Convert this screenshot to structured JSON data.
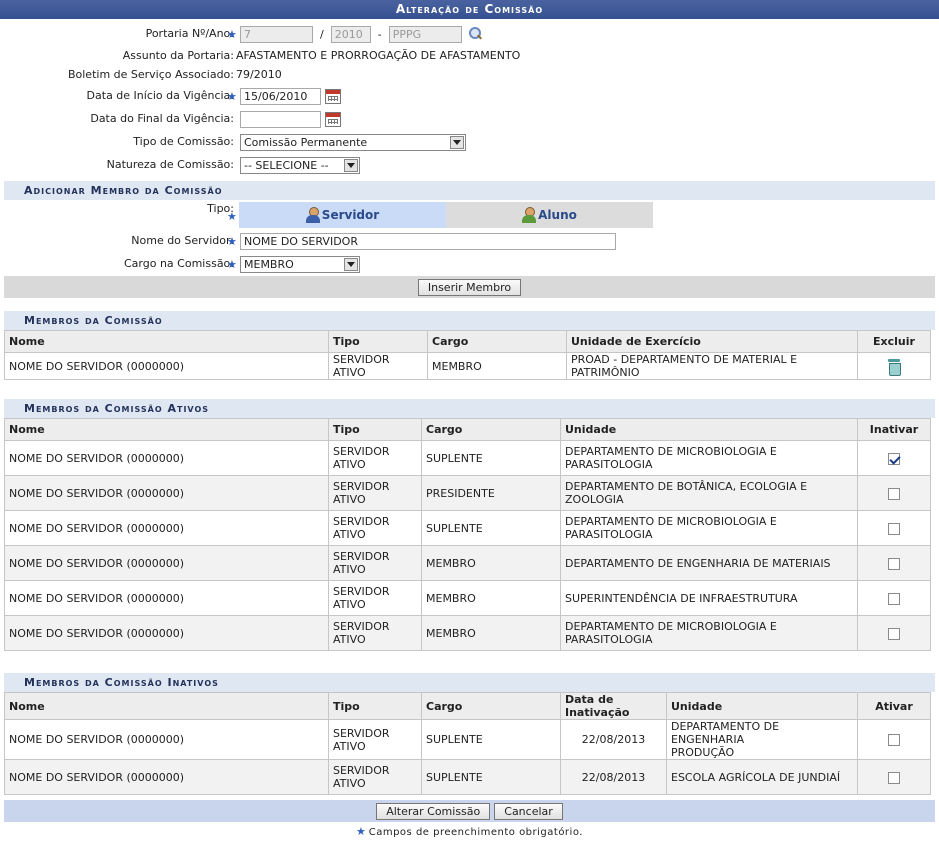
{
  "window": {
    "title": "Alteração de Comissão"
  },
  "form": {
    "portaria": {
      "label": "Portaria Nº/Ano:",
      "numero": "7",
      "sep1": "/",
      "ano": "2010",
      "sep2": "-",
      "sigla": "PPPG"
    },
    "assunto": {
      "label": "Assunto da Portaria:",
      "value": "AFASTAMENTO E PRORROGAÇÃO DE AFASTAMENTO"
    },
    "boletim": {
      "label": "Boletim de Serviço Associado:",
      "value": "79/2010"
    },
    "inicio": {
      "label": "Data de Início da Vigência:",
      "value": "15/06/2010"
    },
    "final": {
      "label": "Data do Final da Vigência:",
      "value": ""
    },
    "tipo": {
      "label": "Tipo de Comissão:",
      "value": "Comissão Permanente"
    },
    "natureza": {
      "label": "Natureza de Comissão:",
      "value": "-- SELECIONE --"
    }
  },
  "adicionar": {
    "title": "Adicionar Membro da Comissão",
    "tipo_label": "Tipo:",
    "tab_servidor": "Servidor",
    "tab_aluno": "Aluno",
    "nome_label": "Nome do Servidor:",
    "nome_value": "NOME DO SERVIDOR",
    "cargo_label": "Cargo na Comissão:",
    "cargo_value": "MEMBRO",
    "inserir_button": "Inserir Membro"
  },
  "membros": {
    "title": "Membros da Comissão",
    "headers": [
      "Nome",
      "Tipo",
      "Cargo",
      "Unidade de Exercício",
      "Excluir"
    ],
    "rows": [
      {
        "nome": "NOME DO SERVIDOR (0000000)",
        "tipo": "SERVIDOR ATIVO",
        "cargo": "MEMBRO",
        "unidade": "PROAD - DEPARTAMENTO DE MATERIAL E PATRIMÔNIO"
      }
    ]
  },
  "ativos": {
    "title": "Membros da Comissão Ativos",
    "headers": [
      "Nome",
      "Tipo",
      "Cargo",
      "Unidade",
      "Inativar"
    ],
    "rows": [
      {
        "nome": "NOME DO SERVIDOR (0000000)",
        "tipo1": "SERVIDOR",
        "tipo2": "ATIVO",
        "cargo": "SUPLENTE",
        "unidade": "DEPARTAMENTO DE MICROBIOLOGIA E PARASITOLOGIA",
        "checked": true
      },
      {
        "nome": "NOME DO SERVIDOR (0000000)",
        "tipo1": "SERVIDOR",
        "tipo2": "ATIVO",
        "cargo": "PRESIDENTE",
        "unidade": "DEPARTAMENTO DE BOTÂNICA, ECOLOGIA E ZOOLOGIA",
        "checked": false
      },
      {
        "nome": "NOME DO SERVIDOR (0000000)",
        "tipo1": "SERVIDOR",
        "tipo2": "ATIVO",
        "cargo": "SUPLENTE",
        "unidade": "DEPARTAMENTO DE MICROBIOLOGIA E PARASITOLOGIA",
        "checked": false
      },
      {
        "nome": "NOME DO SERVIDOR (0000000)",
        "tipo1": "SERVIDOR",
        "tipo2": "ATIVO",
        "cargo": "MEMBRO",
        "unidade": "DEPARTAMENTO DE ENGENHARIA DE MATERIAIS",
        "checked": false
      },
      {
        "nome": "NOME DO SERVIDOR (0000000)",
        "tipo1": "SERVIDOR",
        "tipo2": "ATIVO",
        "cargo": "MEMBRO",
        "unidade": "SUPERINTENDÊNCIA DE INFRAESTRUTURA",
        "checked": false
      },
      {
        "nome": "NOME DO SERVIDOR (0000000)",
        "tipo1": "SERVIDOR",
        "tipo2": "ATIVO",
        "cargo": "MEMBRO",
        "unidade": "DEPARTAMENTO DE MICROBIOLOGIA E PARASITOLOGIA",
        "checked": false
      }
    ]
  },
  "inativos": {
    "title": "Membros da Comissão Inativos",
    "headers": [
      "Nome",
      "Tipo",
      "Cargo",
      "Data de Inativação",
      "Unidade",
      "Ativar"
    ],
    "rows": [
      {
        "nome": "NOME DO SERVIDOR (0000000)",
        "tipo1": "SERVIDOR",
        "tipo2": "ATIVO",
        "cargo": "SUPLENTE",
        "data": "22/08/2013",
        "unidade1": "DEPARTAMENTO DE ENGENHARIA",
        "unidade2": "PRODUÇÃO"
      },
      {
        "nome": "NOME DO SERVIDOR (0000000)",
        "tipo1": "SERVIDOR",
        "tipo2": "ATIVO",
        "cargo": "SUPLENTE",
        "data": "22/08/2013",
        "unidade1": "ESCOLA AGRÍCOLA DE JUNDIAÍ",
        "unidade2": ""
      }
    ]
  },
  "footer": {
    "alterar_button": "Alterar Comissão",
    "cancelar_button": "Cancelar",
    "required_note": "Campos de preenchimento obrigatório.",
    "required_mark": "★"
  },
  "colors": {
    "title_bar": "#3b5998",
    "section_bg": "#dfe7f3",
    "tab_active": "#c9dbf6",
    "required_star": "#3060c0"
  }
}
